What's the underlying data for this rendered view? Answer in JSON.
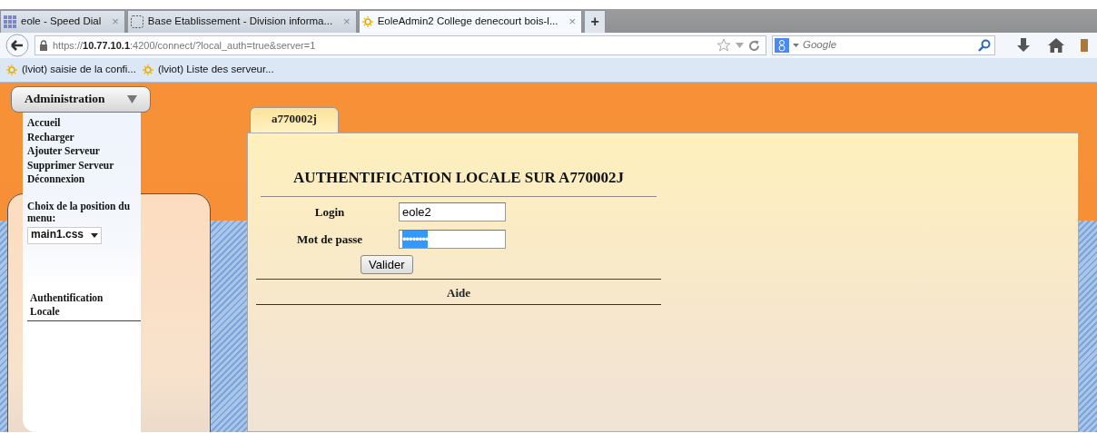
{
  "browser": {
    "tabs": [
      {
        "title": "eole - Speed Dial",
        "close": "×",
        "selected": false,
        "kind": "grid"
      },
      {
        "title": "Base Etablissement - Division informa...",
        "close": "×",
        "selected": false,
        "kind": "dashed"
      },
      {
        "title": "EoleAdmin2 College denecourt bois-l...",
        "close": "×",
        "selected": true,
        "kind": "sun"
      }
    ],
    "new_tab": "+",
    "url": "https://**10.77.10.1**:4200/connect/?local_auth=true&server=1",
    "search": {
      "placeholder": "Google"
    },
    "bookmarks": [
      {
        "label": "(lviot) saisie de la confi..."
      },
      {
        "label": "(lviot) Liste des serveur..."
      }
    ]
  },
  "menu": {
    "title": "Administration",
    "items": [
      "Accueil",
      "Recharger",
      "Ajouter Serveur",
      "Supprimer Serveur",
      "Déconnexion"
    ],
    "position_label": "Choix de la position du menu:",
    "position_value": "main1.css",
    "section": "Authentification Locale"
  },
  "content": {
    "tab": "a770002j",
    "heading": "AUTHENTIFICATION LOCALE SUR A770002J",
    "fields": [
      {
        "label": "Login",
        "value": "eole2",
        "kind": "text"
      },
      {
        "label": "Mot de passe",
        "value": "••••••••",
        "kind": "password"
      }
    ],
    "submit": "Valider",
    "help": "Aide"
  }
}
